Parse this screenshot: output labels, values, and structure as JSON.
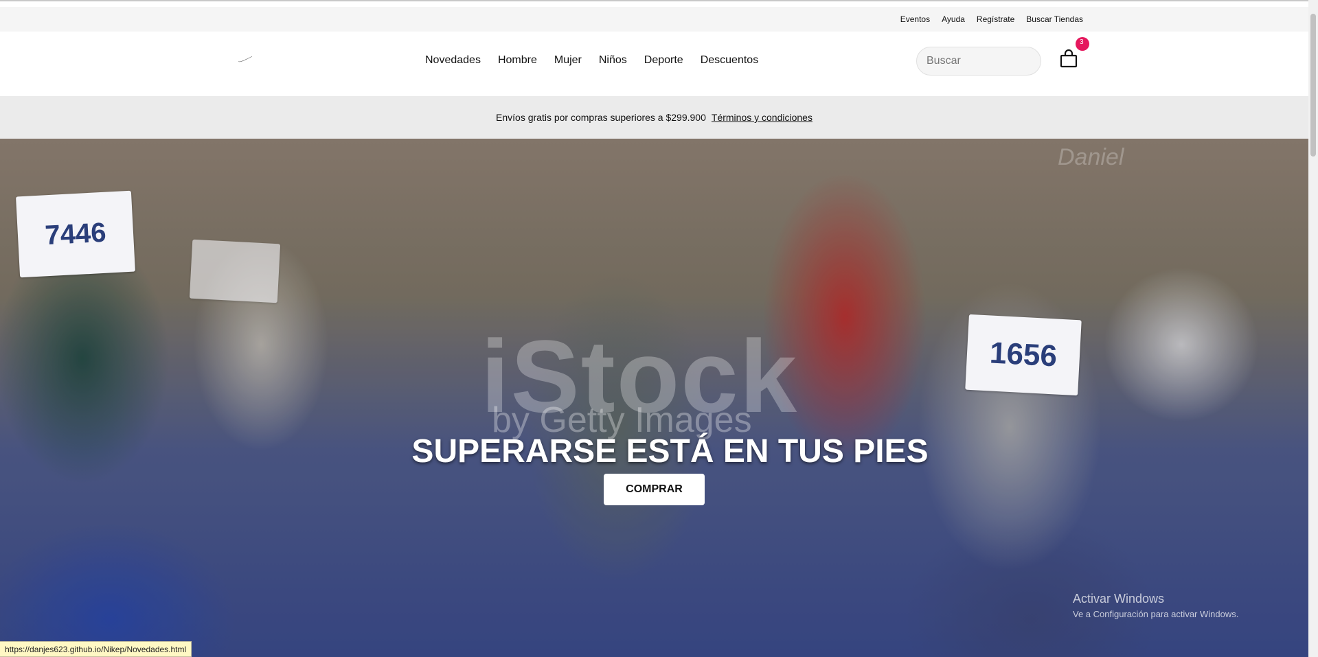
{
  "utility_nav": {
    "links": [
      "Eventos",
      "Ayuda",
      "Regístrate",
      "Buscar Tiendas"
    ]
  },
  "header": {
    "logo_icon": "nike-swoosh-icon",
    "nav_items": [
      "Novedades",
      "Hombre",
      "Mujer",
      "Niños",
      "Deporte",
      "Descuentos"
    ],
    "search_placeholder": "Buscar",
    "cart_icon": "shopping-bag-icon",
    "cart_count": "3"
  },
  "promo_banner": {
    "text": "Envíos gratis por compras superiores a $299.900",
    "link": "Términos y condiciones"
  },
  "hero": {
    "title": "SUPERARSE ESTÁ EN TUS PIES",
    "button": "COMPRAR",
    "watermark_brand": "iStock",
    "watermark_by": "by Getty Images",
    "watermark_credit": "Daniel",
    "bib_numbers": [
      "7446",
      "1656"
    ]
  },
  "system_overlay": {
    "activate_title": "Activar Windows",
    "activate_subtitle": "Ve a Configuración para activar Windows."
  },
  "status_bar": {
    "url": "https://danjes623.github.io/Nikep/Novedades.html"
  },
  "colors": {
    "cart_badge": "#e5185d",
    "promo_bg": "#ebebeb",
    "utility_bg": "#f5f5f5"
  }
}
